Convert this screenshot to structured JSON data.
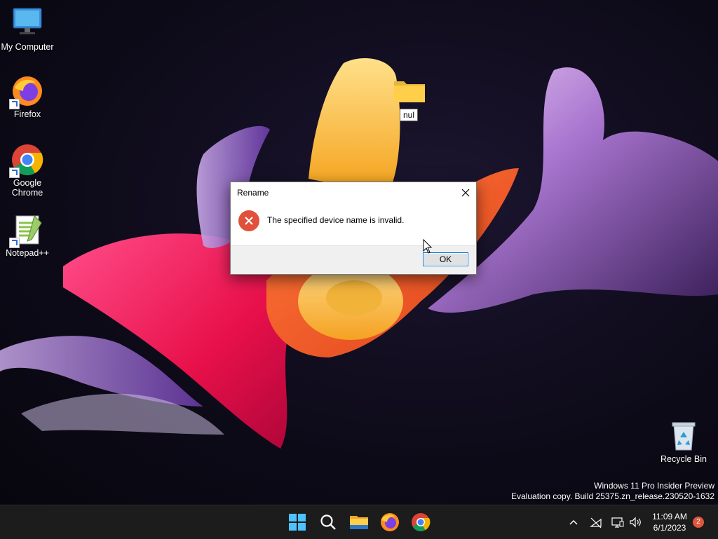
{
  "desktop": {
    "icons": [
      {
        "label": "My Computer"
      },
      {
        "label": "Firefox"
      },
      {
        "label": "Google Chrome"
      },
      {
        "label": "Notepad++"
      },
      {
        "label": "Recycle Bin"
      }
    ],
    "folder": {
      "label": "nul"
    }
  },
  "dialog": {
    "title": "Rename",
    "message": "The specified device name is invalid.",
    "ok_label": "OK",
    "icon": "error-icon"
  },
  "watermark": {
    "line1": "Windows 11 Pro Insider Preview",
    "line2": "Evaluation copy. Build 25375.zn_release.230520-1632"
  },
  "taskbar": {
    "time": "11:09 AM",
    "date": "6/1/2023",
    "notifications": "2",
    "pinned": [
      "start-icon",
      "search-icon",
      "file-explorer-icon",
      "firefox-icon",
      "chrome-icon"
    ],
    "tray": [
      "chevron-up-icon",
      "network-off-icon",
      "display-icon",
      "speaker-icon"
    ]
  },
  "colors": {
    "taskbar_bg": "#1c1c1c",
    "accent": "#0078d4",
    "error_red": "#e0503a",
    "notif_badge": "#e0573f"
  }
}
